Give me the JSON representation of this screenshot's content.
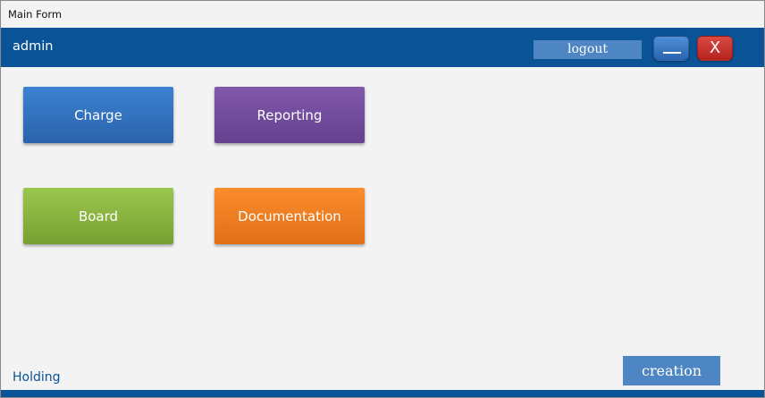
{
  "window": {
    "title": "Main Form"
  },
  "header": {
    "user": "admin",
    "logout_label": "logout",
    "minimize_label": "",
    "close_label": "X"
  },
  "tiles": [
    {
      "label": "Charge",
      "color": "#3c82d2"
    },
    {
      "label": "Reporting",
      "color": "#7a52a6"
    },
    {
      "label": "Board",
      "color": "#8fbd45"
    },
    {
      "label": "Documentation",
      "color": "#f7861f"
    }
  ],
  "footer": {
    "holding": "Holding",
    "creation_label": "creation"
  },
  "colors": {
    "header_bg": "#0a5397",
    "accent_button": "#4d86c3",
    "close_button": "#c8302b",
    "minimize_button": "#3a78c4"
  }
}
